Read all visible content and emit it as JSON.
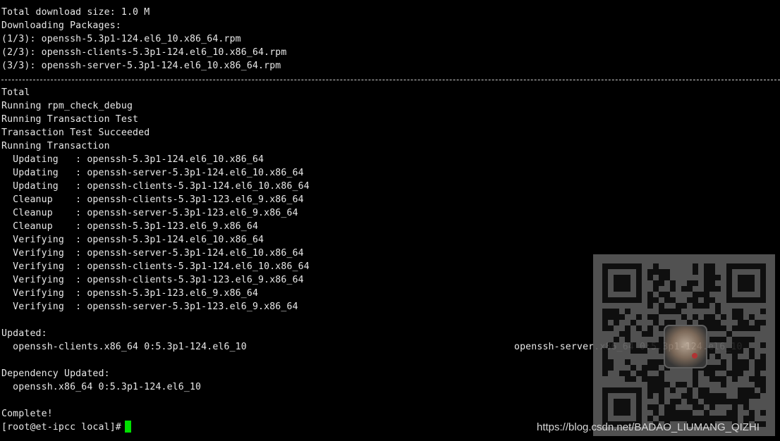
{
  "terminal": {
    "lines": [
      "Total download size: 1.0 M",
      "Downloading Packages:",
      "(1/3): openssh-5.3p1-124.el6_10.x86_64.rpm",
      "(2/3): openssh-clients-5.3p1-124.el6_10.x86_64.rpm",
      "(3/3): openssh-server-5.3p1-124.el6_10.x86_64.rpm",
      "",
      "Total",
      "Running rpm_check_debug",
      "Running Transaction Test",
      "Transaction Test Succeeded",
      "Running Transaction",
      "  Updating   : openssh-5.3p1-124.el6_10.x86_64",
      "  Updating   : openssh-server-5.3p1-124.el6_10.x86_64",
      "  Updating   : openssh-clients-5.3p1-124.el6_10.x86_64",
      "  Cleanup    : openssh-clients-5.3p1-123.el6_9.x86_64",
      "  Cleanup    : openssh-server-5.3p1-123.el6_9.x86_64",
      "  Cleanup    : openssh-5.3p1-123.el6_9.x86_64",
      "  Verifying  : openssh-5.3p1-124.el6_10.x86_64",
      "  Verifying  : openssh-server-5.3p1-124.el6_10.x86_64",
      "  Verifying  : openssh-clients-5.3p1-124.el6_10.x86_64",
      "  Verifying  : openssh-clients-5.3p1-123.el6_9.x86_64",
      "  Verifying  : openssh-5.3p1-123.el6_9.x86_64",
      "  Verifying  : openssh-server-5.3p1-123.el6_9.x86_64",
      "",
      "Updated:",
      "  openssh-clients.x86_64 0:5.3p1-124.el6_10",
      "",
      "Dependency Updated:",
      "  openssh.x86_64 0:5.3p1-124.el6_10",
      "",
      "Complete!",
      "[root@et-ipcc local]# "
    ],
    "updated_right": "openssh-server.x86_64 0:5.3p1-124.el6_10",
    "colors": {
      "background": "#000000",
      "text": "#e8e8e8",
      "cursor": "#00e000"
    }
  },
  "watermark": {
    "text": "https://blog.csdn.net/BADAO_LIUMANG_QIZHI",
    "qr_icon": "qr-code-icon"
  }
}
